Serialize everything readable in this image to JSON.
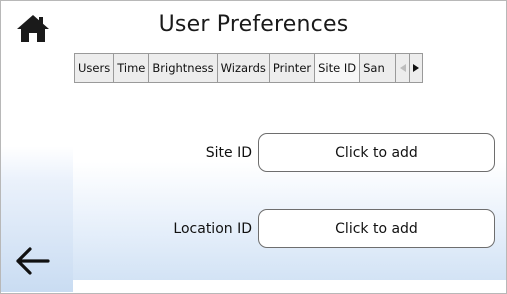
{
  "header": {
    "title": "User Preferences"
  },
  "tabs": [
    {
      "label": "Users"
    },
    {
      "label": "Time"
    },
    {
      "label": "Brightness"
    },
    {
      "label": "Wizards"
    },
    {
      "label": "Printer"
    },
    {
      "label": "Site ID",
      "active": true
    },
    {
      "label": "San"
    }
  ],
  "form": {
    "site_id": {
      "label": "Site ID",
      "value": "Click to add"
    },
    "location_id": {
      "label": "Location ID",
      "value": "Click to add"
    }
  },
  "icons": {
    "home": "home-icon",
    "back": "arrow-left-icon",
    "scroll_left": "caret-left-icon",
    "scroll_right": "caret-right-icon"
  },
  "colors": {
    "gradient_end": "#c9dcf2",
    "border": "#6e6e6e"
  }
}
